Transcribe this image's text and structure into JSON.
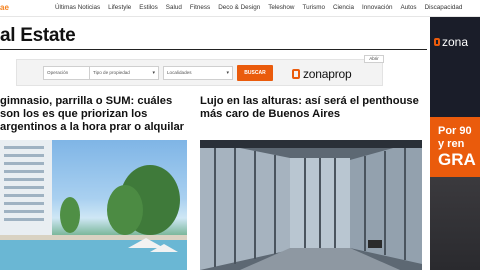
{
  "header": {
    "logo_fragment": "ae",
    "nav": [
      "Últimas Noticias",
      "Lifestyle",
      "Estilos",
      "Salud",
      "Fitness",
      "Deco & Design",
      "Teleshow",
      "Turismo",
      "Ciencia",
      "Innovación",
      "Autos",
      "Discapacidad"
    ]
  },
  "section": {
    "title": "al Estate"
  },
  "widget": {
    "operation_placeholder": "Operación",
    "property_type_placeholder": "Tipo de propiedad",
    "location_placeholder": "Localidades",
    "search_label": "BUSCAR",
    "brand": "zonaprop",
    "open_label": "Abrir"
  },
  "articles": [
    {
      "headline": "gimnasio, parrilla o SUM: cuáles son los es que priorizan los argentinos a la hora prar o alquilar",
      "image": "building-pool-photo"
    },
    {
      "headline": "Lujo en las alturas: así será el penthouse más caro de Buenos Aires",
      "image": "penthouse-interior-photo"
    }
  ],
  "ad": {
    "brand": "zona",
    "line1": "Por 90",
    "line2": "y ren",
    "line3": "GRA"
  },
  "colors": {
    "accent": "#ea5b0c",
    "logo": "#f58220"
  }
}
